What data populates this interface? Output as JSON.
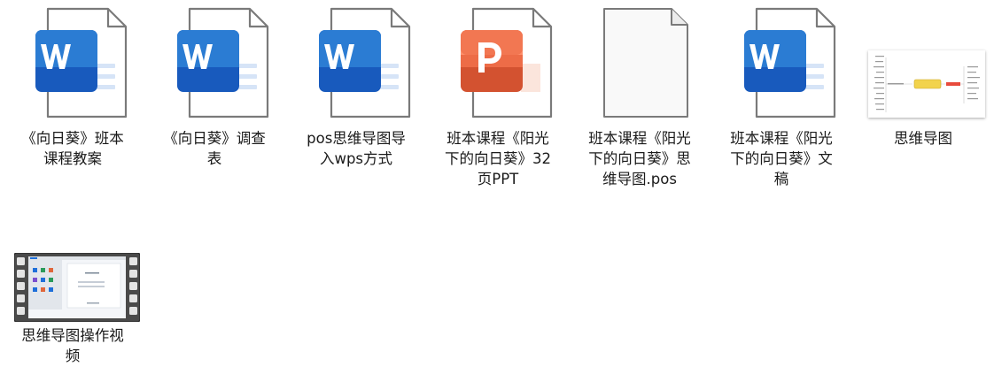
{
  "files": [
    {
      "name": "《向日葵》班本课程教案",
      "type": "word"
    },
    {
      "name": "《向日葵》调查表",
      "type": "word"
    },
    {
      "name": "pos思维导图导入wps方式",
      "type": "word"
    },
    {
      "name": "班本课程《阳光下的向日葵》32页PPT",
      "type": "ppt"
    },
    {
      "name": "班本课程《阳光下的向日葵》思维导图.pos",
      "type": "blank"
    },
    {
      "name": "班本课程《阳光下的向日葵》文稿",
      "type": "word"
    },
    {
      "name": "思维导图",
      "type": "image"
    },
    {
      "name": "思维导图操作视频",
      "type": "video"
    }
  ],
  "colors": {
    "word": "#185ABD",
    "ppt": "#D35230",
    "page_outline": "#7a7a7a",
    "label_text": "#1a1a1a"
  },
  "icons": [
    "word-document-icon",
    "powerpoint-document-icon",
    "blank-document-icon",
    "mindmap-image-thumbnail",
    "video-file-thumbnail"
  ]
}
